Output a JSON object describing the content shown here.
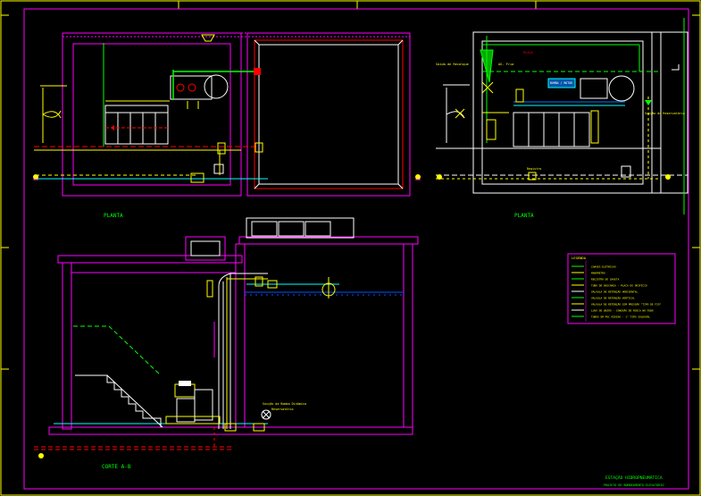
{
  "drawing": {
    "label_plan_left": "PLANTA",
    "label_plan_right": "PLANTA",
    "label_section": "CORTE A-B",
    "title_line1": "ESTAÇÃO HIDROPNEUMÁTICA",
    "title_line2": "PROJETO DE BOMBEAMENTO ELEVATÓRIO"
  },
  "plan_right_notes": {
    "tag_left": "Saída de Recalque",
    "tag_top": "PLACA",
    "tag_mid": "AG. Fria",
    "tag_box": "BOMBA / MOTOR",
    "tag_right": "Sucção do Reservatório",
    "tag_bottom": "Registro"
  },
  "section_notes": {
    "tag_valve": "Sucção da Bomba Dinâmica",
    "tag_valve2": "Reservatório"
  },
  "legend": {
    "title": "LEGENDA",
    "items": [
      "CHAVES ELÉTRICAS",
      "MANÔMETRO",
      "REGISTRO DE GAVETA",
      "TUBO DE DESCARGA - PLACA DE ORIFÍCIO",
      "VÁLVULA DE RETENÇÃO HORIZONTAL",
      "VÁLVULA DE RETENÇÃO VERTICAL",
      "VÁLVULA DE RETENÇÃO COM PRESSÃO \"TIPO DE FIO\"",
      "LUVA DE UNIÃO - CONEXÃO DE ROSCA NO TUBO",
      "TUBOS EM PVC RÍGIDO - 1\" TIPO SOLDÁVEL"
    ]
  },
  "colors": {
    "frame": "#ff00ff",
    "wall": "#ff00ff",
    "pipe_supply": "#00ff00",
    "pipe_yellow": "#ffff00",
    "pipe_red": "#ff0000",
    "pipe_cyan": "#00ffff",
    "text_green": "#00ff00",
    "white": "#ffffff"
  }
}
